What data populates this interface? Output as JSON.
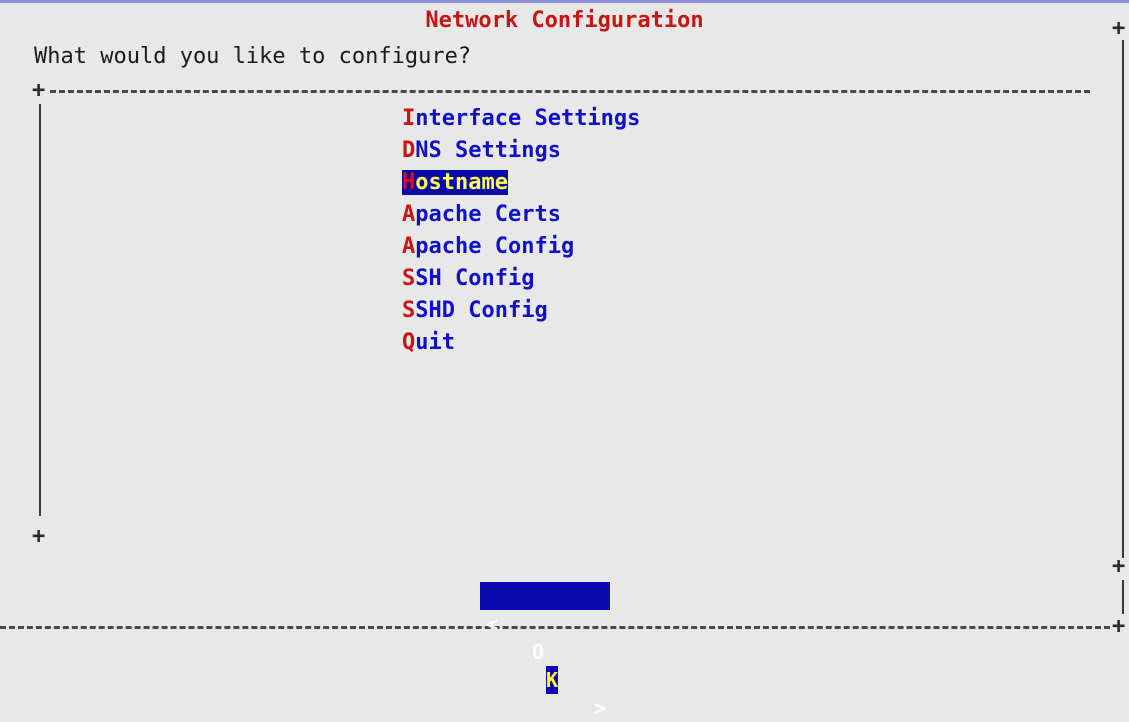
{
  "dialog": {
    "title": "Network Configuration",
    "prompt": "What would you like to configure?"
  },
  "menu": {
    "items": [
      {
        "hotkey": "I",
        "rest": "nterface Settings"
      },
      {
        "hotkey": "D",
        "rest": "NS Settings"
      },
      {
        "hotkey": "H",
        "rest": "ostname"
      },
      {
        "hotkey": "A",
        "rest": "pache Certs"
      },
      {
        "hotkey": "A",
        "rest": "pache Config"
      },
      {
        "hotkey": "S",
        "rest": "SH Config"
      },
      {
        "hotkey": "S",
        "rest": "SHD Config"
      },
      {
        "hotkey": "Q",
        "rest": "uit"
      }
    ],
    "selected_index": 2
  },
  "buttons": {
    "ok": {
      "left": "<",
      "o": "O",
      "k": "K",
      "right": ">"
    }
  },
  "frame": {
    "corner": "+",
    "vertical": "|"
  },
  "colors": {
    "background": "#e8e8e8",
    "title": "#c81414",
    "item_text": "#1010c8",
    "hotkey": "#c81414",
    "selection_bg": "#0a0aa8",
    "selection_text": "#ffff55"
  }
}
